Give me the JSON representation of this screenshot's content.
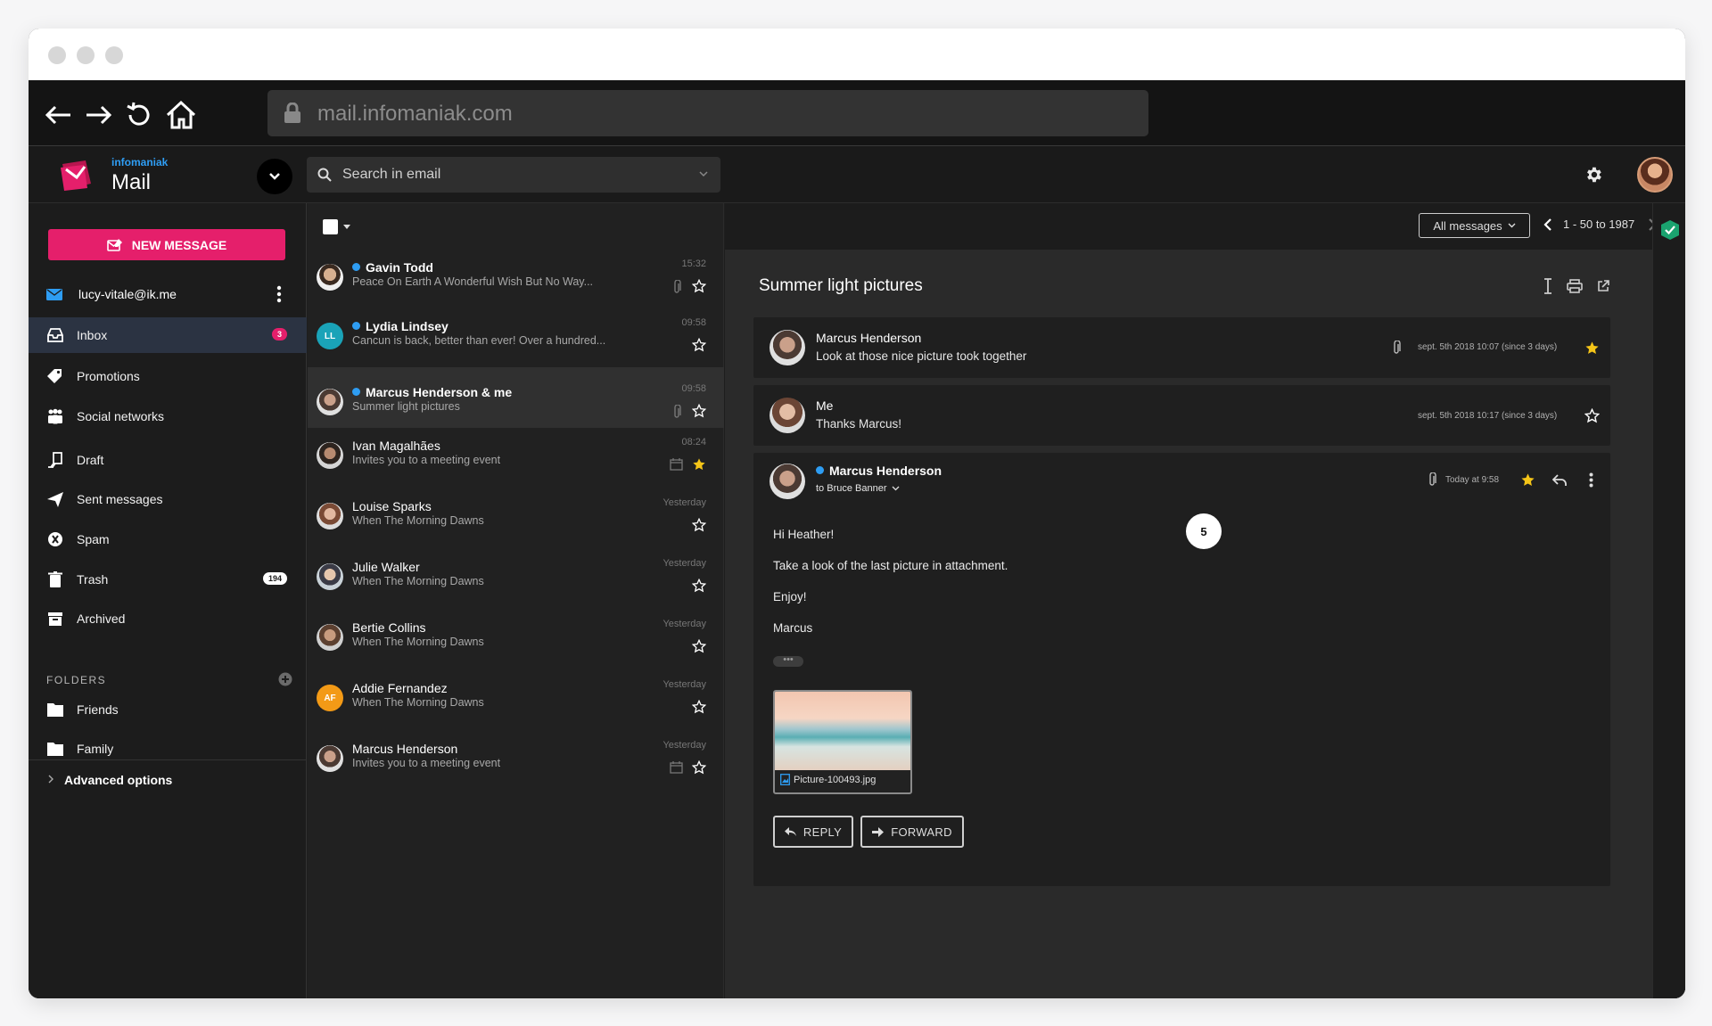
{
  "browser": {
    "url": "mail.infomaniak.com"
  },
  "app": {
    "brand_small": "infomaniak",
    "brand_name": "Mail",
    "search_placeholder": "Search in email"
  },
  "sidebar": {
    "new_message": "NEW MESSAGE",
    "account": "lucy-vitale@ik.me",
    "items": [
      {
        "label": "Inbox",
        "icon": "inbox-icon",
        "badge": "3"
      },
      {
        "label": "Promotions",
        "icon": "tag-icon"
      },
      {
        "label": "Social networks",
        "icon": "people-icon"
      },
      {
        "label": "Draft",
        "icon": "draft-icon"
      },
      {
        "label": "Sent messages",
        "icon": "send-icon"
      },
      {
        "label": "Spam",
        "icon": "spam-icon"
      },
      {
        "label": "Trash",
        "icon": "trash-icon",
        "badge": "194"
      },
      {
        "label": "Archived",
        "icon": "archive-icon"
      }
    ],
    "folders_heading": "FOLDERS",
    "folders": [
      {
        "label": "Friends"
      },
      {
        "label": "Family"
      }
    ],
    "advanced": "Advanced options"
  },
  "list": {
    "filter": "All messages",
    "pager": "1 - 50 to 1987",
    "rows": [
      {
        "name": "Gavin Todd",
        "subject": "Peace On Earth A Wonderful Wish But No Way...",
        "time": "15:32",
        "unread": true,
        "attach": true,
        "starred": false
      },
      {
        "name": "Lydia Lindsey",
        "subject": "Cancun is back, better than ever! Over a hundred...",
        "time": "09:58",
        "unread": true,
        "initials": "LL",
        "starred": false
      },
      {
        "name": "Marcus Henderson & me",
        "subject": "Summer light pictures",
        "time": "09:58",
        "unread": true,
        "attach": true,
        "starred": false,
        "selected": true
      },
      {
        "name": "Ivan Magalhães",
        "subject": "Invites you to a meeting event",
        "time": "08:24",
        "starred": true,
        "calendar": true
      },
      {
        "name": "Louise Sparks",
        "subject": "When The Morning Dawns",
        "time": "Yesterday",
        "starred": false
      },
      {
        "name": "Julie Walker",
        "subject": "When The Morning Dawns",
        "time": "Yesterday",
        "starred": false
      },
      {
        "name": "Bertie Collins",
        "subject": "When The Morning Dawns",
        "time": "Yesterday",
        "starred": false
      },
      {
        "name": "Addie Fernandez",
        "subject": "When The Morning Dawns",
        "time": "Yesterday",
        "initials": "AF",
        "starred": false
      },
      {
        "name": "Marcus Henderson",
        "subject": "Invites you to a meeting event",
        "time": "Yesterday",
        "starred": false,
        "calendar": true
      }
    ]
  },
  "reader": {
    "subject": "Summer light pictures",
    "thread_count": "5",
    "messages": [
      {
        "from": "Marcus Henderson",
        "preview": "Look at those nice picture took together",
        "date": "sept. 5th 2018 10:07 (since 3 days)",
        "starred": true
      },
      {
        "from": "Me",
        "preview": "Thanks Marcus!",
        "date": "sept. 5th 2018 10:17 (since 3 days)",
        "starred": false
      }
    ],
    "open": {
      "from": "Marcus Henderson",
      "to": "to Bruce Banner",
      "date": "Today at 9:58",
      "body": [
        "Hi Heather!",
        "Take a look of the last picture in attachment.",
        "Enjoy!",
        "Marcus"
      ],
      "ellipsis": "•••",
      "attachment": "Picture-100493.jpg",
      "reply": "REPLY",
      "forward": "FORWARD"
    }
  },
  "colors": {
    "accent": "#e51f6b",
    "unread_dot": "#2e9df3",
    "star": "#f5c518",
    "inbox_active": "#2b3342"
  }
}
